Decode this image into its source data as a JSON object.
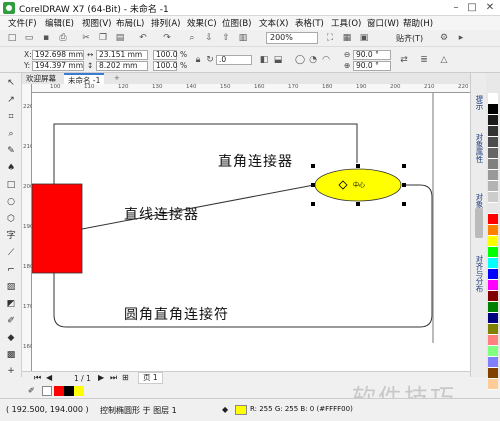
{
  "app": {
    "title": "CorelDRAW X7 (64-Bit) - 未命名 -1"
  },
  "menu": [
    "文件(F)",
    "编辑(E)",
    "视图(V)",
    "布局(L)",
    "排列(A)",
    "效果(C)",
    "位图(B)",
    "文本(X)",
    "表格(T)",
    "工具(O)",
    "窗口(W)",
    "帮助(H)"
  ],
  "toolbar": {
    "zoom": "200%",
    "snap_label": "贴齐(T)"
  },
  "properties": {
    "x": "192.698 mm",
    "y": "194.397 mm",
    "width": "23.151 mm",
    "height": "8.202 mm",
    "scale_w": "100.0",
    "scale_h": "100.0",
    "percent": "%",
    "rotation": ".0",
    "angle1": "90.0 °",
    "angle2": "90.0 °"
  },
  "doc_tabs": [
    "欢迎屏幕",
    "未命名 -1"
  ],
  "ruler": {
    "h_ticks": [
      "100",
      "110",
      "120",
      "130",
      "140",
      "150",
      "160",
      "170",
      "180",
      "190",
      "200",
      "210",
      "220"
    ],
    "v_ticks": [
      "220",
      "210",
      "200",
      "190",
      "180",
      "170",
      "160"
    ]
  },
  "canvas": {
    "label_right_angle": "直角连接器",
    "label_straight": "直线连接器",
    "label_rounded": "圆角直角连接符",
    "ellipse_text": "中心",
    "rect_color": "#ff0000",
    "ellipse_color": "#ffff00"
  },
  "dockers": [
    "提示",
    "对象属性",
    "对象管理器",
    "对齐与分布"
  ],
  "palette": [
    "#ffffff",
    "#000000",
    "#1a1a1a",
    "#333333",
    "#4d4d4d",
    "#666666",
    "#808080",
    "#999999",
    "#b3b3b3",
    "#cccccc",
    "#e6e6e6",
    "#ff0000",
    "#ff8000",
    "#ffff00",
    "#00ff00",
    "#00ffff",
    "#0000ff",
    "#ff00ff",
    "#800000",
    "#008000",
    "#000080",
    "#808000",
    "#ff8080",
    "#80ff80",
    "#8080ff",
    "#804000",
    "#ffcc99"
  ],
  "pagebar": {
    "page_count": "1 / 1",
    "page_tab": "页 1"
  },
  "status": {
    "coords": "( 192.500, 194.000 )",
    "description": "控制椭圆形 于 图层 1",
    "fill_text": "R: 255 G: 255 B: 0 (#FFFF00)"
  },
  "watermark": "软件技巧"
}
